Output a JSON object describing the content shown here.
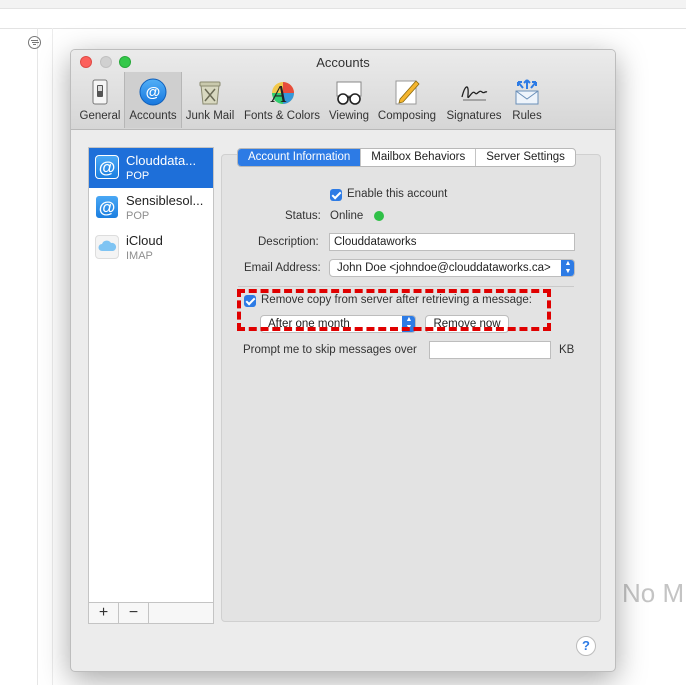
{
  "window": {
    "title": "Accounts"
  },
  "toolbar": {
    "items": [
      {
        "label": "General",
        "icon": "general-switch-icon"
      },
      {
        "label": "Accounts",
        "icon": "at-sign-icon"
      },
      {
        "label": "Junk Mail",
        "icon": "trash-can-icon"
      },
      {
        "label": "Fonts & Colors",
        "icon": "font-color-icon"
      },
      {
        "label": "Viewing",
        "icon": "glasses-icon"
      },
      {
        "label": "Composing",
        "icon": "pencil-paper-icon"
      },
      {
        "label": "Signatures",
        "icon": "signature-icon"
      },
      {
        "label": "Rules",
        "icon": "rules-envelope-icon"
      }
    ],
    "active": "Accounts"
  },
  "accounts": [
    {
      "name": "Clouddata...",
      "type": "POP",
      "icon": "at-sign-icon",
      "selected": true
    },
    {
      "name": "Sensiblesol...",
      "type": "POP",
      "icon": "at-sign-icon",
      "selected": false
    },
    {
      "name": "iCloud",
      "type": "IMAP",
      "icon": "icloud-icon",
      "selected": false
    }
  ],
  "account_list_footer": {
    "add": "+",
    "remove": "−"
  },
  "tabs": [
    {
      "label": "Account Information",
      "active": true
    },
    {
      "label": "Mailbox Behaviors",
      "active": false
    },
    {
      "label": "Server Settings",
      "active": false
    }
  ],
  "form": {
    "enable_label": "Enable this account",
    "enable_checked": true,
    "status_label": "Status:",
    "status_value": "Online",
    "description_label": "Description:",
    "description_value": "Clouddataworks",
    "email_label": "Email Address:",
    "email_value": "John Doe <johndoe@clouddataworks.ca>",
    "remove_copy_label": "Remove copy from server after retrieving a message:",
    "remove_copy_checked": true,
    "remove_period": "After one month",
    "remove_now_label": "Remove now",
    "prompt_label": "Prompt me to skip messages over",
    "prompt_value": "",
    "prompt_unit": "KB"
  },
  "help": {
    "label": "?"
  },
  "background": {
    "no_message_text": "No M"
  },
  "colors": {
    "accent": "#2d7be5",
    "status_online": "#2fc047",
    "highlight": "#e00000"
  }
}
